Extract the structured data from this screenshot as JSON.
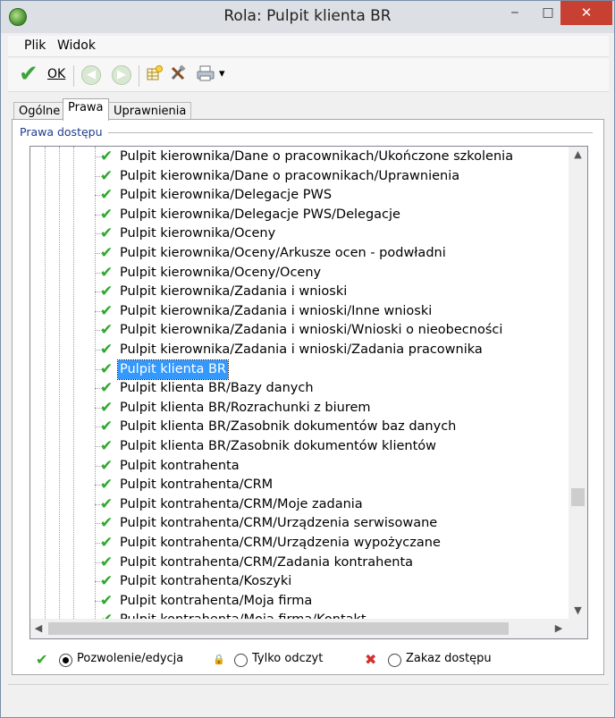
{
  "window": {
    "title": "Rola: Pulpit klienta BR",
    "minimize": "‒",
    "maximize": "□",
    "close": "✕"
  },
  "menu": {
    "file": "Plik",
    "view": "Widok"
  },
  "toolbar": {
    "ok_label": "OK",
    "check_glyph": "✔",
    "back_glyph": "◀",
    "forward_glyph": "▶",
    "dropdown_glyph": "▾"
  },
  "tabs": [
    {
      "label": "Ogólne"
    },
    {
      "label": "Prawa",
      "active": true
    },
    {
      "label": "Uprawnienia"
    }
  ],
  "group": {
    "label": "Prawa dostępu"
  },
  "tree": {
    "check_glyph": "✔",
    "items": [
      {
        "label": "Pulpit kierownika/Dane o pracownikach/Ukończone szkolenia"
      },
      {
        "label": "Pulpit kierownika/Dane o pracownikach/Uprawnienia"
      },
      {
        "label": "Pulpit kierownika/Delegacje PWS"
      },
      {
        "label": "Pulpit kierownika/Delegacje PWS/Delegacje"
      },
      {
        "label": "Pulpit kierownika/Oceny"
      },
      {
        "label": "Pulpit kierownika/Oceny/Arkusze ocen - podwładni"
      },
      {
        "label": "Pulpit kierownika/Oceny/Oceny"
      },
      {
        "label": "Pulpit kierownika/Zadania i wnioski"
      },
      {
        "label": "Pulpit kierownika/Zadania i wnioski/Inne wnioski"
      },
      {
        "label": "Pulpit kierownika/Zadania i wnioski/Wnioski o nieobecności"
      },
      {
        "label": "Pulpit kierownika/Zadania i wnioski/Zadania pracownika"
      },
      {
        "label": "Pulpit klienta BR",
        "selected": true
      },
      {
        "label": "Pulpit klienta BR/Bazy danych"
      },
      {
        "label": "Pulpit klienta BR/Rozrachunki z biurem"
      },
      {
        "label": "Pulpit klienta BR/Zasobnik dokumentów baz danych"
      },
      {
        "label": "Pulpit klienta BR/Zasobnik dokumentów klientów"
      },
      {
        "label": "Pulpit kontrahenta"
      },
      {
        "label": "Pulpit kontrahenta/CRM"
      },
      {
        "label": "Pulpit kontrahenta/CRM/Moje zadania"
      },
      {
        "label": "Pulpit kontrahenta/CRM/Urządzenia serwisowane"
      },
      {
        "label": "Pulpit kontrahenta/CRM/Urządzenia wypożyczane"
      },
      {
        "label": "Pulpit kontrahenta/CRM/Zadania kontrahenta"
      },
      {
        "label": "Pulpit kontrahenta/Koszyki"
      },
      {
        "label": "Pulpit kontrahenta/Moja firma"
      },
      {
        "label": "Pulpit kontrahenta/Moja firma/Kontakt"
      }
    ]
  },
  "scroll": {
    "up": "▲",
    "down": "▼",
    "left": "◀",
    "right": "▶"
  },
  "legend": {
    "allow_label": "Pozwolenie/edycja",
    "readonly_label": "Tylko odczyt",
    "deny_label": "Zakaz dostępu",
    "allow_glyph": "✔",
    "readonly_glyph": "🔒",
    "deny_glyph": "✖",
    "selected": "allow"
  },
  "colors": {
    "check": "#2ea82e",
    "selection": "#3399ff",
    "close_button": "#c84031",
    "deny": "#d32f2f",
    "lock": "#1f4fb4"
  }
}
